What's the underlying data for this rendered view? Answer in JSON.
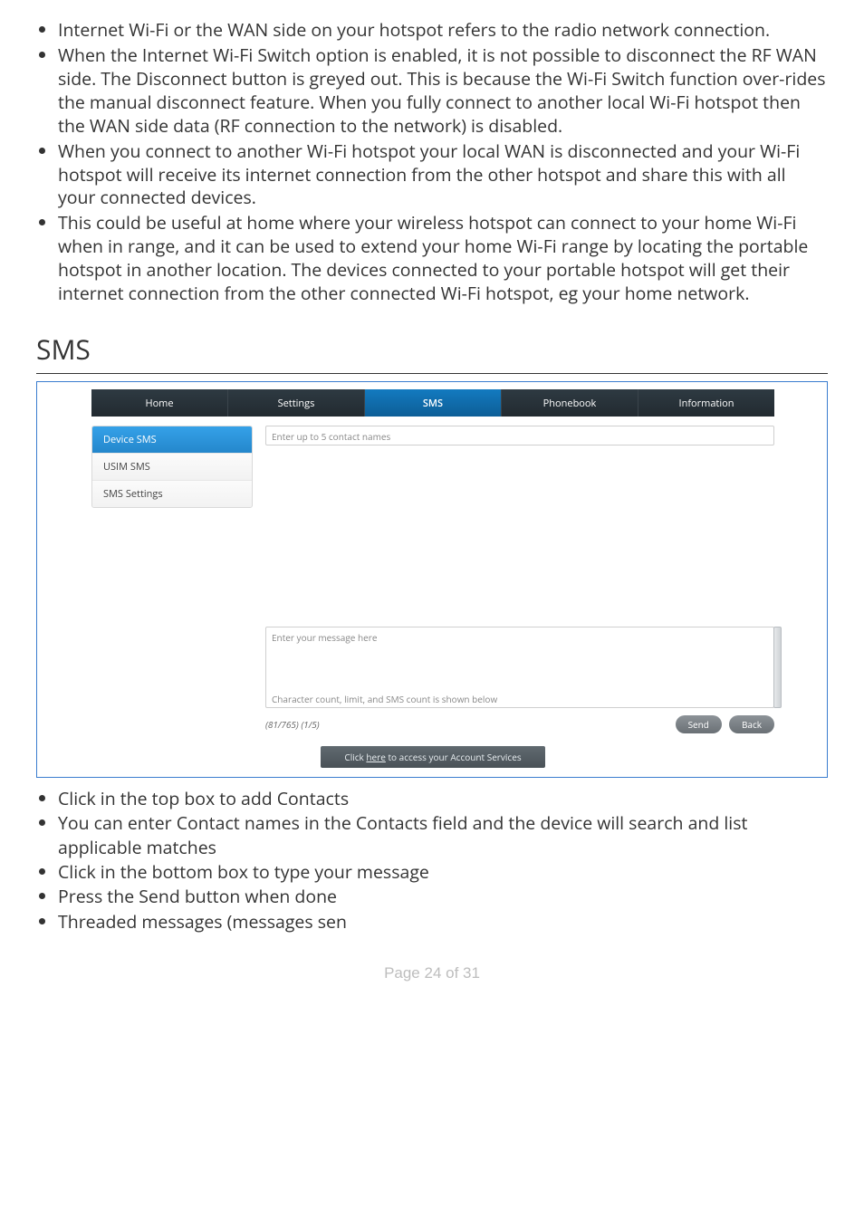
{
  "bullets_top": [
    "Internet Wi-Fi or the WAN side on your hotspot refers to the radio network connection.",
    "When the Internet Wi-Fi Switch option is enabled, it is not possible to disconnect the RF WAN side. The Disconnect button is greyed out. This is because the Wi-Fi Switch function over-rides the manual disconnect feature. When you fully connect to another local Wi-Fi hotspot then the WAN side data (RF connection to the network) is disabled.",
    "When you connect to another Wi-Fi hotspot your local WAN is disconnected and your Wi-Fi hotspot will receive its internet connection from the other hotspot and share this with all your connected devices.",
    "This could be useful at home where your wireless hotspot can connect to your home Wi-Fi when in range, and it can be used to extend your home Wi-Fi range by locating the portable hotspot in another location. The devices connected to your portable hotspot will get their internet connection from the other connected Wi-Fi hotspot, eg your home network."
  ],
  "heading": "SMS",
  "ui": {
    "tabs": [
      "Home",
      "Settings",
      "SMS",
      "Phonebook",
      "Information"
    ],
    "active_tab_index": 2,
    "sidebar": [
      {
        "label": "Device SMS",
        "active": true
      },
      {
        "label": "USIM SMS",
        "active": false
      },
      {
        "label": "SMS Settings",
        "active": false
      }
    ],
    "contacts_placeholder": "Enter up to 5 contact names",
    "message_placeholder": "Enter your message here",
    "message_hint": "Character count, limit, and SMS count is shown below",
    "counter": "(81/765) (1/5)",
    "buttons": {
      "send": "Send",
      "back": "Back"
    },
    "account_prefix": "Click ",
    "account_link": "here",
    "account_suffix": " to access your Account Services"
  },
  "bullets_bottom": [
    "Click in the top box to add Contacts",
    "You can enter Contact names in the Contacts field and the device will search and list applicable matches",
    "Click in the bottom box to type your message",
    "Press the Send button when done",
    "Threaded messages (messages sen"
  ],
  "footer": "Page 24 of 31"
}
